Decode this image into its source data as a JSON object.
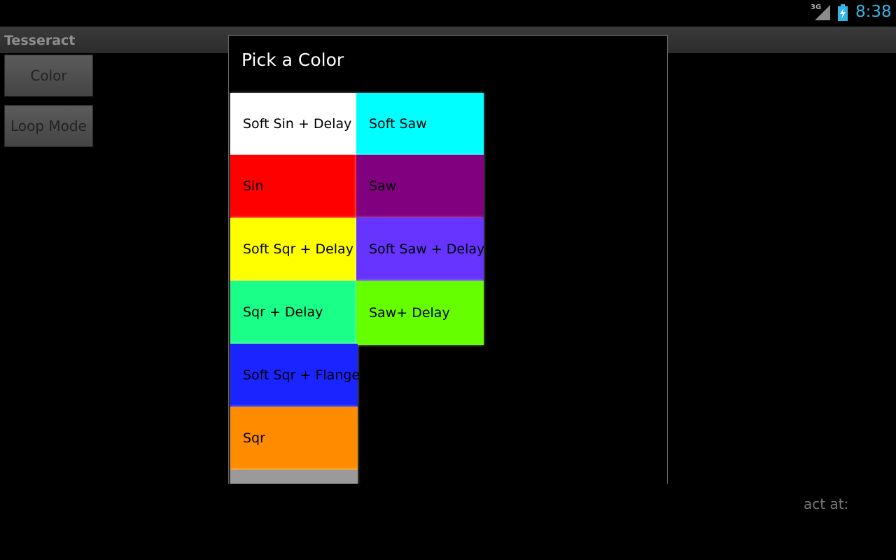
{
  "status_bar": {
    "network": "3G",
    "time": "8:38",
    "time_color": "#33b5e5",
    "icons": [
      "signal-icon",
      "battery-charging-icon"
    ]
  },
  "app": {
    "title": "Tesseract"
  },
  "side_buttons": [
    {
      "label": "Color"
    },
    {
      "label": "Loop Mode"
    }
  ],
  "dialog": {
    "title": "Pick a Color",
    "options": [
      {
        "label": "Soft Sin + Delay",
        "color": "#ffffff"
      },
      {
        "label": "Soft Saw",
        "color": "#00ffff"
      },
      {
        "label": "Sin",
        "color": "#ff0000"
      },
      {
        "label": "Saw",
        "color": "#800080"
      },
      {
        "label": "Soft Sqr + Delay",
        "color": "#ffff00"
      },
      {
        "label": "Soft Saw + Delay",
        "color": "#6633ff"
      },
      {
        "label": "Sqr + Delay",
        "color": "#19ff88"
      },
      {
        "label": "Saw+ Delay",
        "color": "#66ff00"
      },
      {
        "label": "Soft Sqr + Flange",
        "color": "#1a24ff"
      },
      {
        "label": "Sqr",
        "color": "#ff8c00"
      },
      {
        "label": "",
        "color": "#9a9a9a"
      }
    ]
  },
  "background_text": "act at:"
}
